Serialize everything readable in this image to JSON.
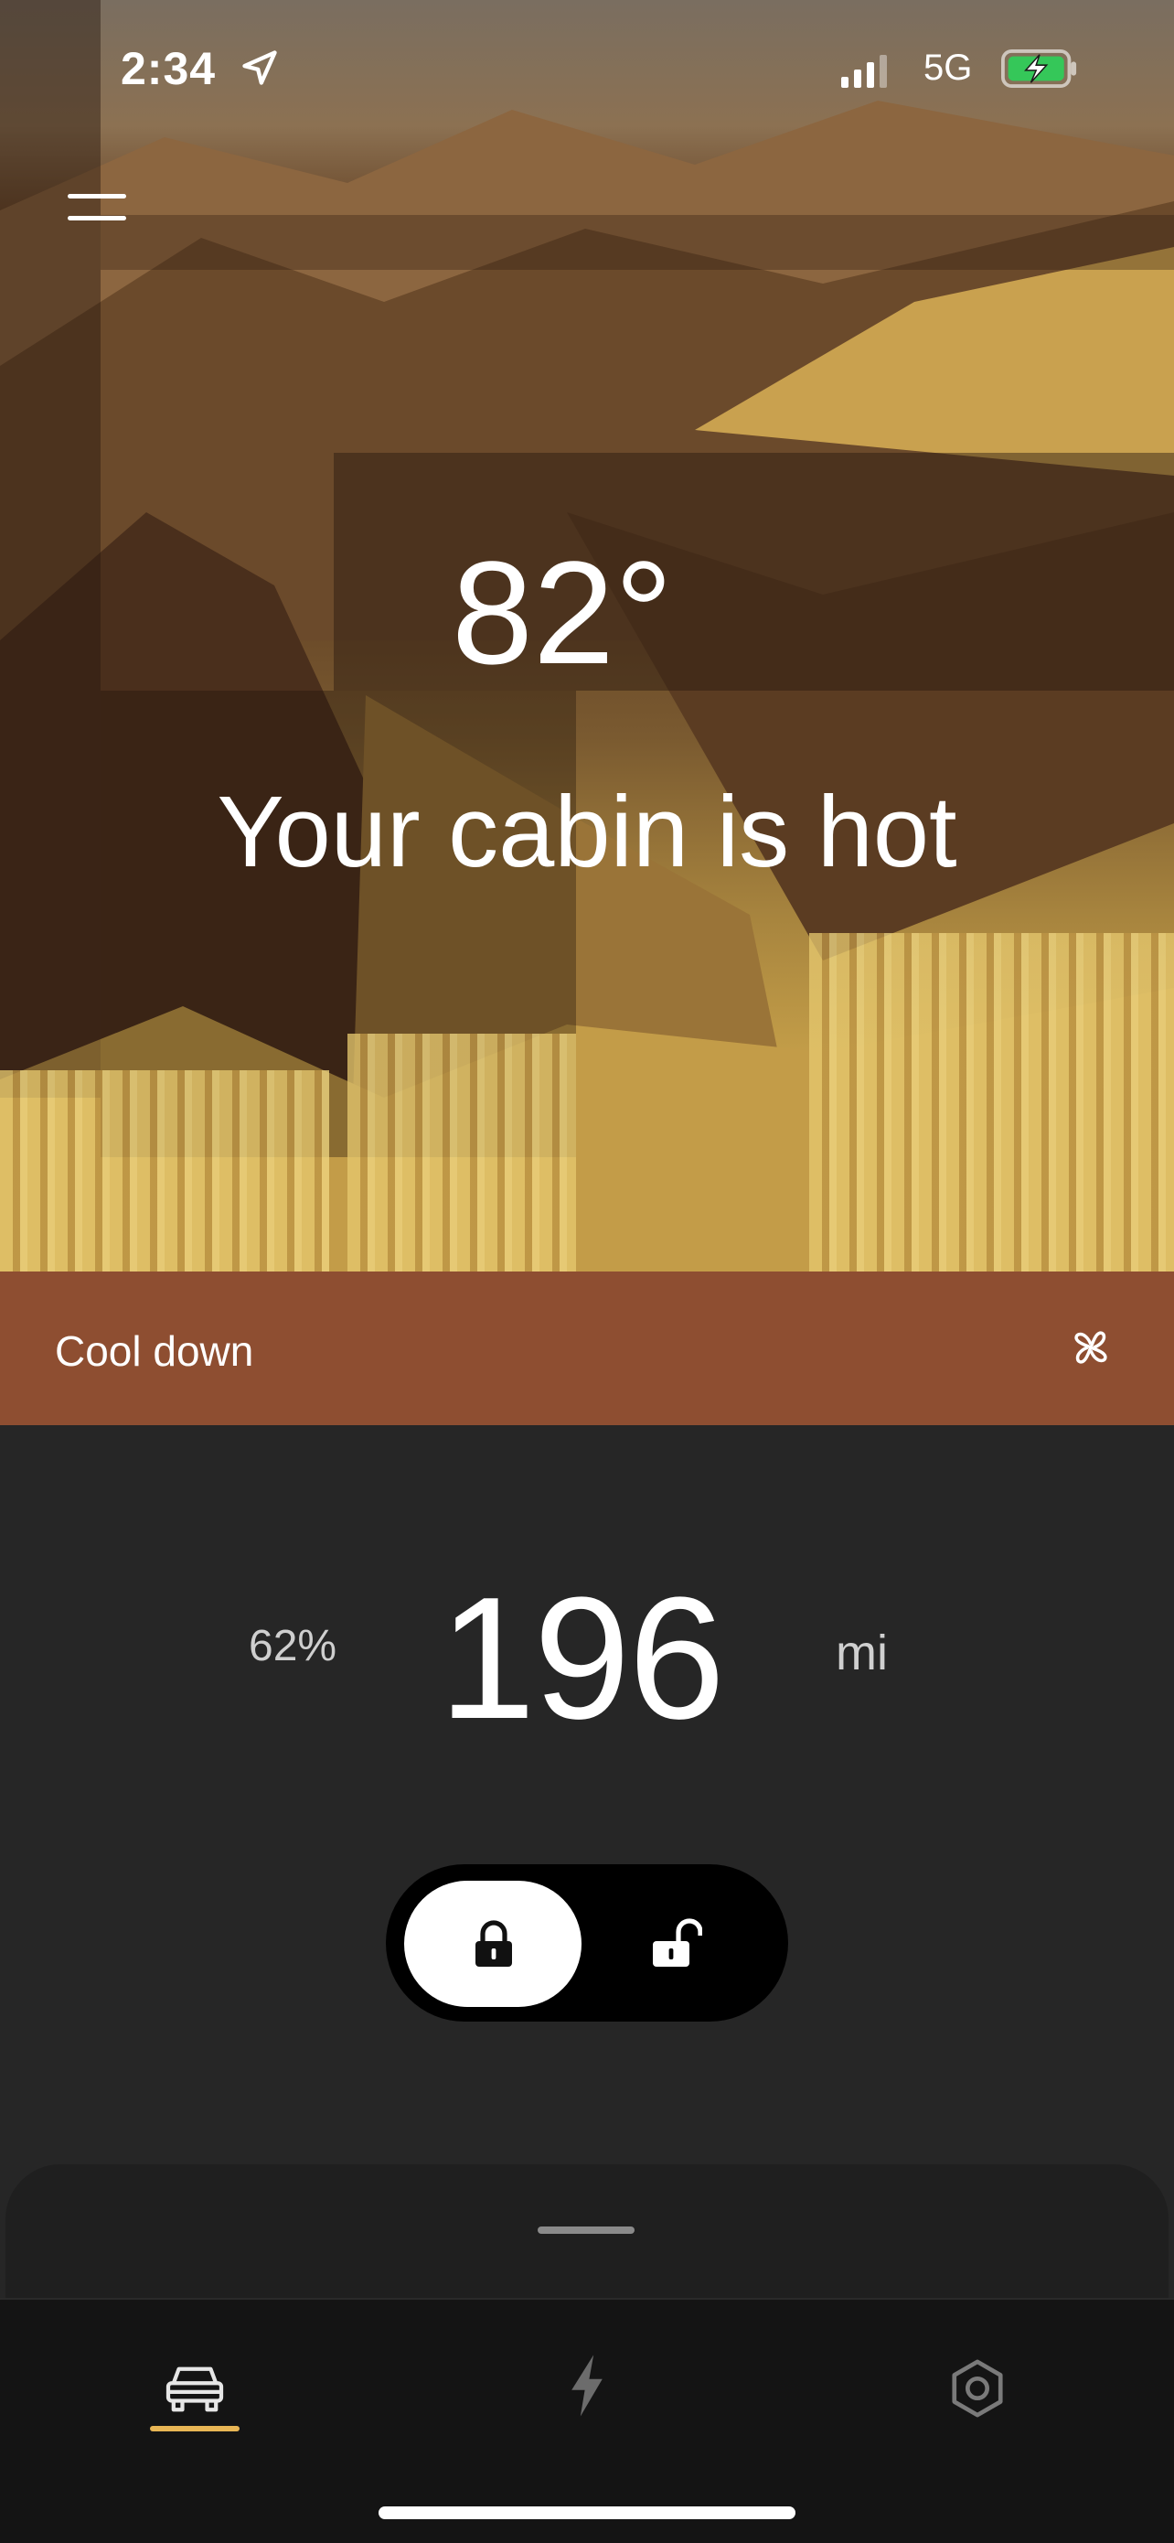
{
  "status_bar": {
    "time": "2:34",
    "network": "5G"
  },
  "hero": {
    "temperature": "82°",
    "headline": "Your cabin is hot"
  },
  "climate_action": {
    "label": "Cool down",
    "icon": "fan-icon"
  },
  "range": {
    "battery_percent": "62%",
    "value": "196",
    "unit": "mi"
  },
  "lock_toggle": {
    "selected": "locked",
    "options": [
      "lock-icon",
      "unlock-icon"
    ]
  },
  "tab_bar": {
    "tabs": [
      "car-icon",
      "energy-icon",
      "settings-icon"
    ],
    "active": "car-icon"
  },
  "colors": {
    "accent": "#e8b655",
    "cool_bar": "#8e4e31",
    "background": "#262626",
    "battery_green": "#35c759"
  }
}
